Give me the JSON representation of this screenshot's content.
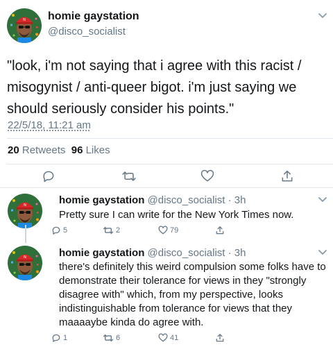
{
  "main_tweet": {
    "display_name": "homie gaystation",
    "handle": "@disco_socialist",
    "text": "\"look, i'm not saying that i agree with this racist / misogynist / anti-queer bigot. i'm just saying we should seriously consider his points.\"",
    "timestamp": "22/5/18, 11:21 am",
    "retweets_count": "20",
    "retweets_label": "Retweets",
    "likes_count": "96",
    "likes_label": "Likes",
    "actions": [
      "reply-icon",
      "retweet-icon",
      "like-icon",
      "share-icon"
    ]
  },
  "replies": [
    {
      "display_name": "homie gaystation",
      "meta": "@disco_socialist · 3h",
      "text": "Pretty sure I can write for the New York Times now.",
      "reply_count": "5",
      "retweet_count": "2",
      "like_count": "79"
    },
    {
      "display_name": "homie gaystation",
      "meta": "@disco_socialist · 3h",
      "text": "there's definitely this weird compulsion some folks have to demonstrate their tolerance for views in they \"strongly disagree with\" which, from my perspective, looks indistinguishable from tolerance for views that they maaaaybe kinda do agree with.",
      "reply_count": "1",
      "retweet_count": "6",
      "like_count": "41"
    }
  ],
  "colors": {
    "text_primary": "#14171a",
    "text_secondary": "#657786",
    "divider": "#e1e8ed",
    "avatar_bg": "#2e7d32",
    "avatar_hat": "#d62828"
  }
}
